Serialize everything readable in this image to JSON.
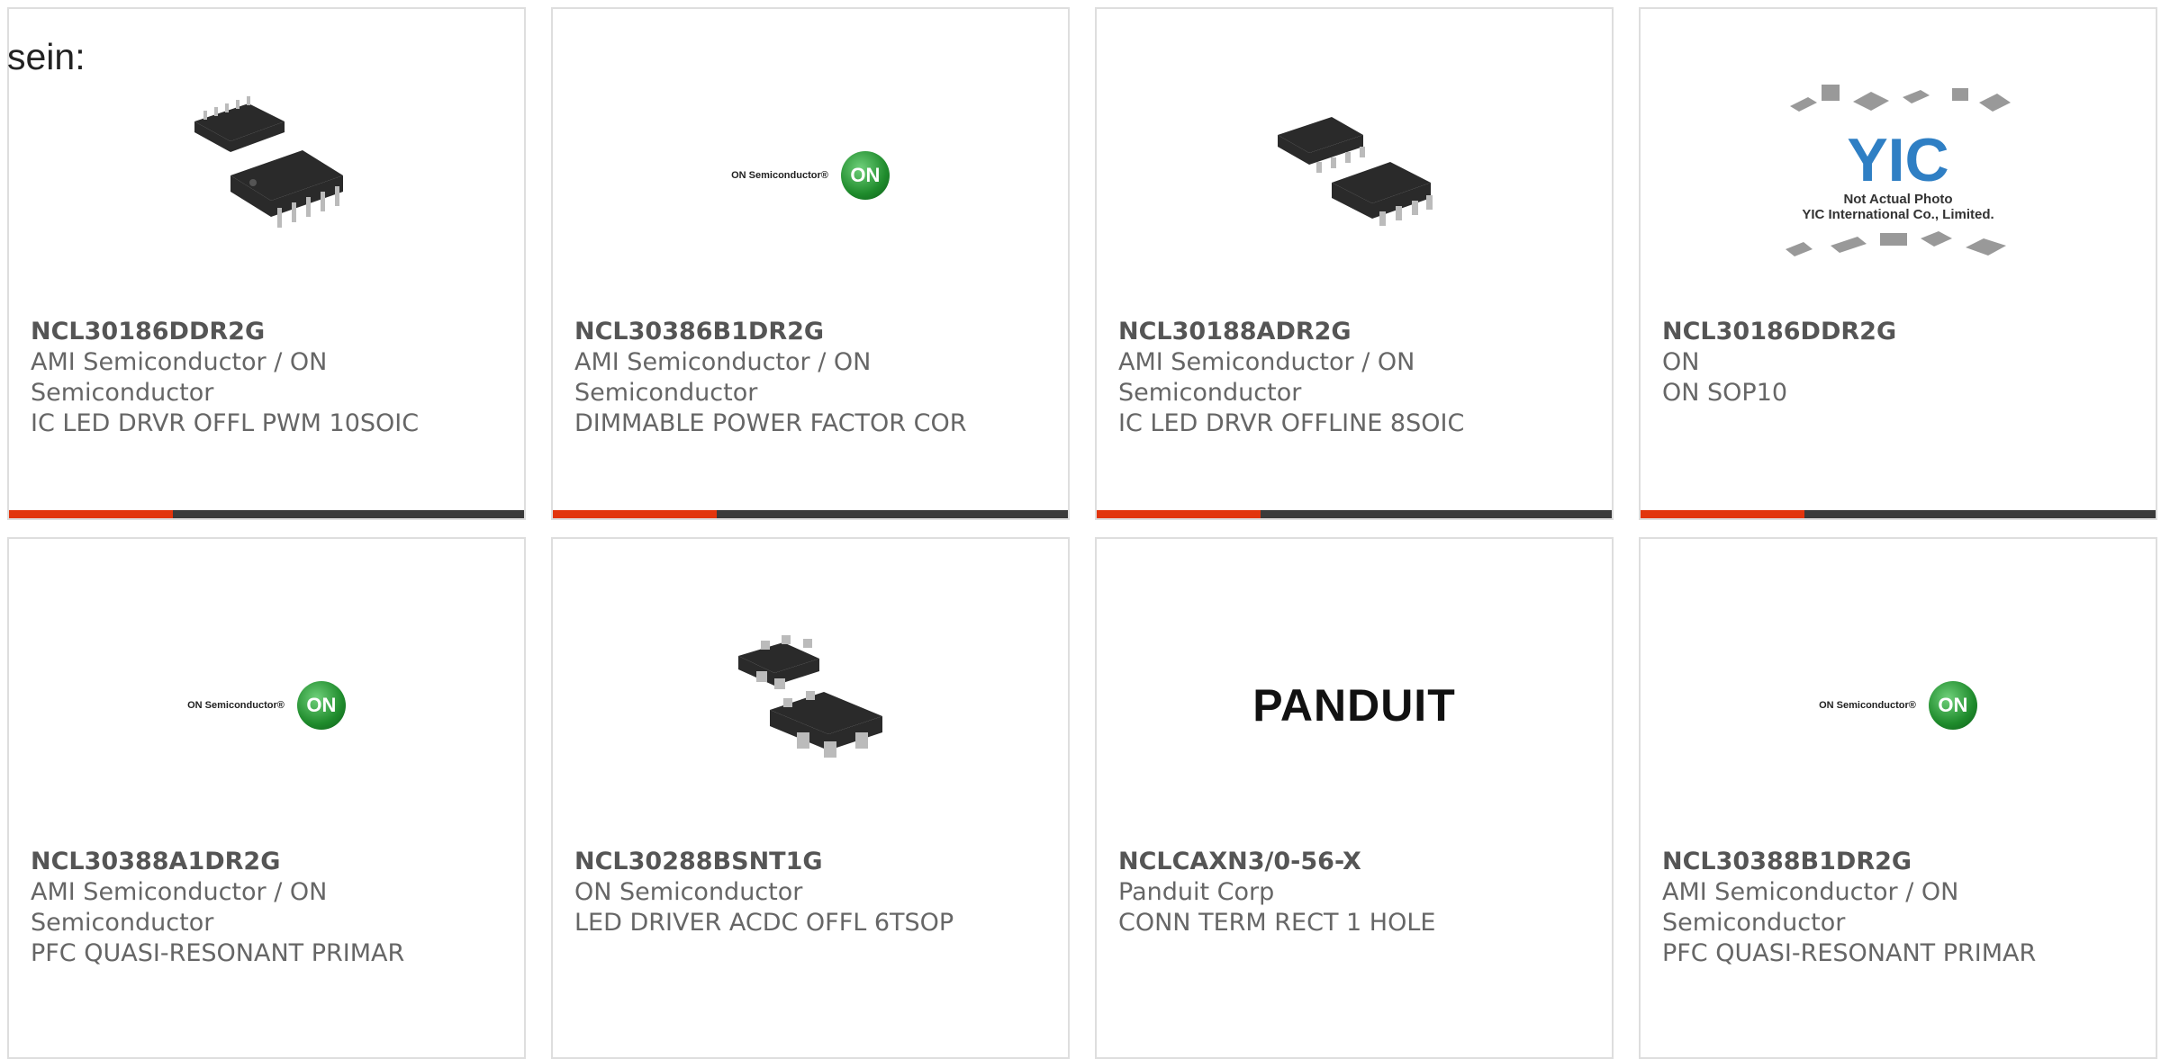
{
  "intro": "sein:",
  "cards": [
    {
      "part": "NCL30186DDR2G",
      "manufacturer": "AMI Semiconductor / ON Semiconductor",
      "description": "IC LED DRVR OFFL PWM 10SOIC",
      "image": "chip-msop10-image"
    },
    {
      "part": "NCL30386B1DR2G",
      "manufacturer": "AMI Semiconductor / ON Semiconductor",
      "description": "DIMMABLE POWER FACTOR COR",
      "image": "on-semiconductor-logo"
    },
    {
      "part": "NCL30188ADR2G",
      "manufacturer": "AMI Semiconductor / ON Semiconductor",
      "description": "IC LED DRVR OFFLINE 8SOIC",
      "image": "chip-soic8-image"
    },
    {
      "part": "NCL30186DDR2G",
      "manufacturer": "ON",
      "description": "ON SOP10",
      "image": "yic-placeholder-image"
    },
    {
      "part": "NCL30388A1DR2G",
      "manufacturer": "AMI Semiconductor / ON Semiconductor",
      "description": "PFC QUASI-RESONANT PRIMAR",
      "image": "on-semiconductor-logo"
    },
    {
      "part": "NCL30288BSNT1G",
      "manufacturer": "ON Semiconductor",
      "description": "LED DRIVER ACDC OFFL 6TSOP",
      "image": "chip-tsop6-image"
    },
    {
      "part": "NCLCAXN3/0-56-X",
      "manufacturer": "Panduit Corp",
      "description": "CONN TERM RECT 1 HOLE",
      "image": "panduit-logo"
    },
    {
      "part": "NCL30388B1DR2G",
      "manufacturer": "AMI Semiconductor / ON Semiconductor",
      "description": "PFC QUASI-RESONANT PRIMAR",
      "image": "on-semiconductor-logo"
    }
  ],
  "logos": {
    "on_text": "ON Semiconductor®",
    "on_mark": "ON",
    "panduit": "PANDUIT",
    "yic_mark": "YIC",
    "yic_line1": "Not Actual Photo",
    "yic_line2": "YIC International Co., Limited."
  },
  "colors": {
    "accent": "#e2350d",
    "bar": "#3a3a3a",
    "border": "#dedede",
    "on_green": "#1f8b2c"
  }
}
